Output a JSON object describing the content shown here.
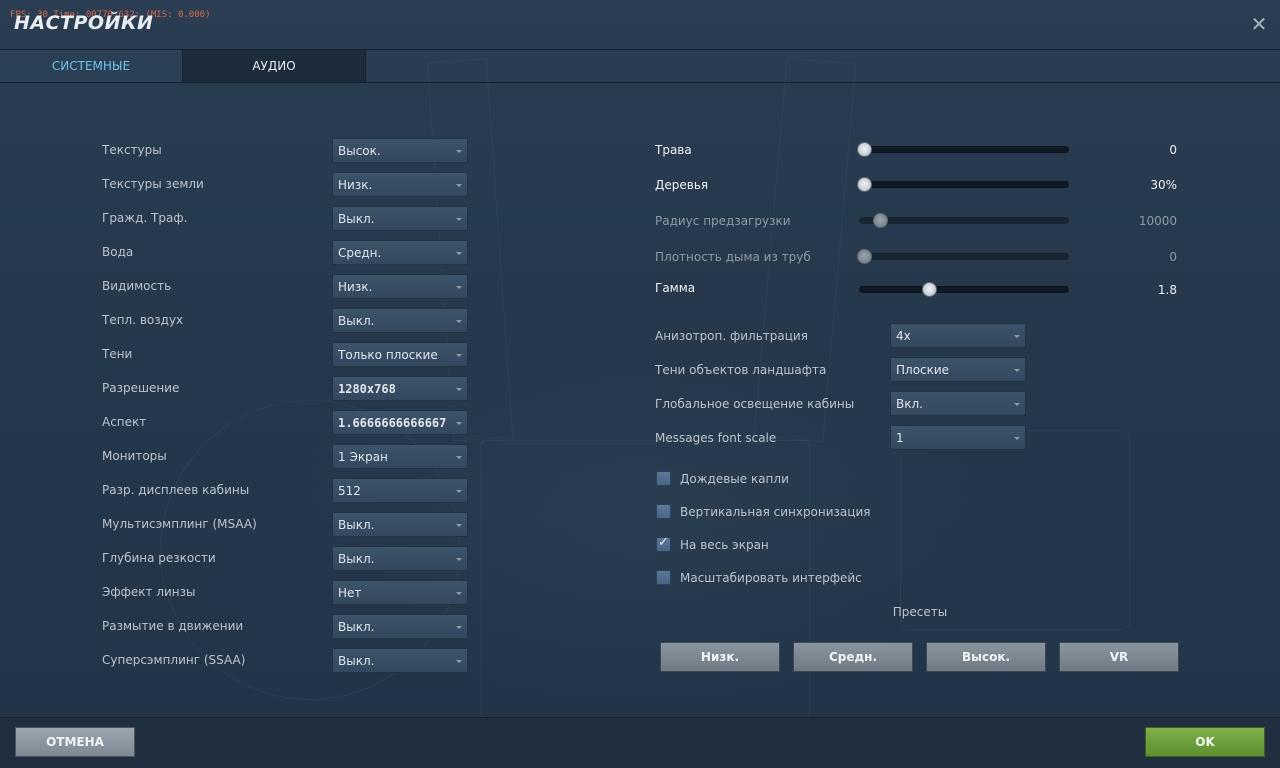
{
  "window": {
    "title": "НАСТРОЙКИ",
    "fps_overlay": "FPS: 30 Time: 00770.632; (MIS: 0.000)",
    "close_icon": "close-icon"
  },
  "tabs": [
    {
      "label": "СИСТЕМНЫЕ",
      "active": true
    },
    {
      "label": "АУДИО",
      "active": false
    }
  ],
  "left_settings": [
    {
      "label": "Текстуры",
      "value": "Высок."
    },
    {
      "label": "Текстуры земли",
      "value": "Низк."
    },
    {
      "label": "Гражд. Траф.",
      "value": "Выкл."
    },
    {
      "label": "Вода",
      "value": "Средн."
    },
    {
      "label": "Видимость",
      "value": "Низк."
    },
    {
      "label": "Тепл. воздух",
      "value": "Выкл."
    },
    {
      "label": "Тени",
      "value": "Только плоские"
    },
    {
      "label": "Разрешение",
      "value": "1280x768"
    },
    {
      "label": "Аспект",
      "value": "1.6666666666667"
    },
    {
      "label": "Мониторы",
      "value": "1 Экран"
    },
    {
      "label": "Разр. дисплеев кабины",
      "value": "512"
    },
    {
      "label": "Мультисэмплинг (MSAA)",
      "value": "Выкл."
    },
    {
      "label": "Глубина резкости",
      "value": "Выкл."
    },
    {
      "label": "Эффект линзы",
      "value": "Нет"
    },
    {
      "label": "Размытие в движении",
      "value": "Выкл."
    },
    {
      "label": "Суперсэмплинг (SSAA)",
      "value": "Выкл."
    }
  ],
  "sliders": [
    {
      "label": "Трава",
      "value": "0",
      "level": 0.0,
      "enabled": true
    },
    {
      "label": "Деревья",
      "value": "30%",
      "level": 0.0,
      "enabled": true
    },
    {
      "label": "Радиус предзагрузки",
      "value": "10000",
      "level": 0.08,
      "enabled": false
    },
    {
      "label": "Плотность дыма из труб",
      "value": "0",
      "level": 0.0,
      "enabled": false
    },
    {
      "label": "Гамма",
      "value": "1.8",
      "level": 0.33,
      "enabled": true
    }
  ],
  "right_settings": [
    {
      "label": "Анизотроп. фильтрация",
      "value": "4x"
    },
    {
      "label": "Тени объектов ландшафта",
      "value": "Плоские"
    },
    {
      "label": "Глобальное освещение кабины",
      "value": "Вкл."
    },
    {
      "label": "Messages font scale",
      "value": "1"
    }
  ],
  "checkboxes": [
    {
      "label": "Дождевые капли",
      "checked": false
    },
    {
      "label": "Вертикальная синхронизация",
      "checked": false
    },
    {
      "label": "На весь экран",
      "checked": true
    },
    {
      "label": "Масштабировать интерфейс",
      "checked": false
    }
  ],
  "presets": {
    "title": "Пресеты",
    "buttons": [
      "Низк.",
      "Средн.",
      "Высок.",
      "VR"
    ]
  },
  "footer": {
    "cancel_label": "ОТМЕНА",
    "ok_label": "OK"
  },
  "colors": {
    "accent_tab": "#6fc3e8",
    "ok_green": "#6e9f3c",
    "background": "#26384c"
  }
}
